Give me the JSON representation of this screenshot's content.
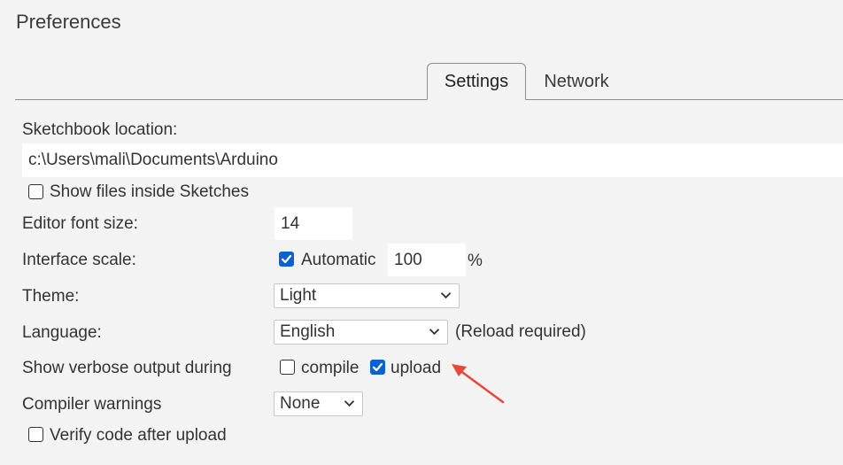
{
  "window": {
    "title": "Preferences"
  },
  "tabs": [
    {
      "label": "Settings",
      "active": true
    },
    {
      "label": "Network",
      "active": false
    }
  ],
  "settings": {
    "sketchbook_label": "Sketchbook location:",
    "sketchbook_value": "c:\\Users\\mali\\Documents\\Arduino",
    "show_files_label": "Show files inside Sketches",
    "show_files_checked": false,
    "font_size_label": "Editor font size:",
    "font_size_value": "14",
    "scale_label": "Interface scale:",
    "scale_auto_label": "Automatic",
    "scale_auto_checked": true,
    "scale_value": "100",
    "scale_unit": "%",
    "theme_label": "Theme:",
    "theme_value": "Light",
    "language_label": "Language:",
    "language_value": "English",
    "language_note": "(Reload required)",
    "verbose_label": "Show verbose output during",
    "verbose_compile_label": "compile",
    "verbose_compile_checked": false,
    "verbose_upload_label": "upload",
    "verbose_upload_checked": true,
    "warnings_label": "Compiler warnings",
    "warnings_value": "None",
    "verify_label": "Verify code after upload",
    "verify_checked": false
  },
  "colors": {
    "background": "#f3f3f3",
    "checkbox_checked": "#0a61d1",
    "annotation_arrow": "#e8473b"
  },
  "icons": [
    "checkmark-icon",
    "chevron-down-icon",
    "annotation-arrow"
  ]
}
